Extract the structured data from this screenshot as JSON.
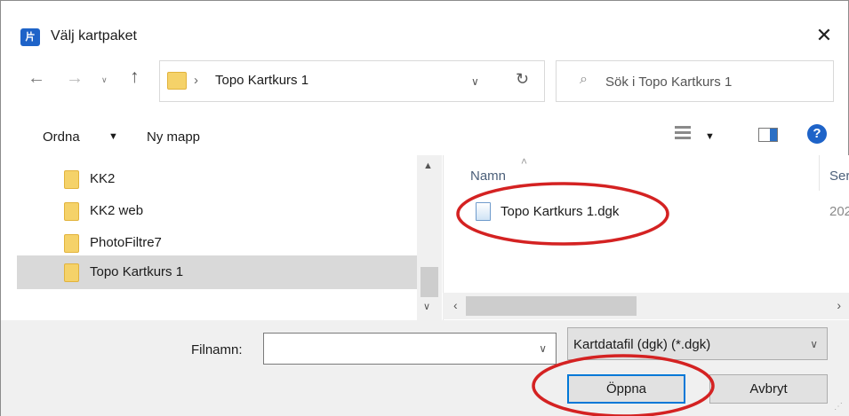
{
  "window": {
    "title": "Välj kartpaket"
  },
  "nav": {
    "address_path": "Topo Kartkurs 1",
    "search_placeholder": "Sök i Topo Kartkurs 1"
  },
  "toolbar": {
    "organize_label": "Ordna",
    "new_folder_label": "Ny mapp"
  },
  "sidebar": {
    "items": [
      {
        "label": "KK2",
        "selected": false
      },
      {
        "label": "KK2 web",
        "selected": false
      },
      {
        "label": "PhotoFiltre7",
        "selected": false
      },
      {
        "label": "Topo Kartkurs 1",
        "selected": true
      }
    ]
  },
  "filelist": {
    "columns": [
      "Namn",
      "Ser"
    ],
    "files": [
      {
        "name": "Topo Kartkurs 1.dgk",
        "date": "202"
      }
    ]
  },
  "footer": {
    "filename_label": "Filnamn:",
    "filename_value": "",
    "filter": "Kartdatafil (dgk) (*.dgk)",
    "open_label": "Öppna",
    "cancel_label": "Avbryt"
  },
  "colors": {
    "annotation": "#d42222",
    "accent": "#0078d7",
    "folder": "#f5d269"
  }
}
